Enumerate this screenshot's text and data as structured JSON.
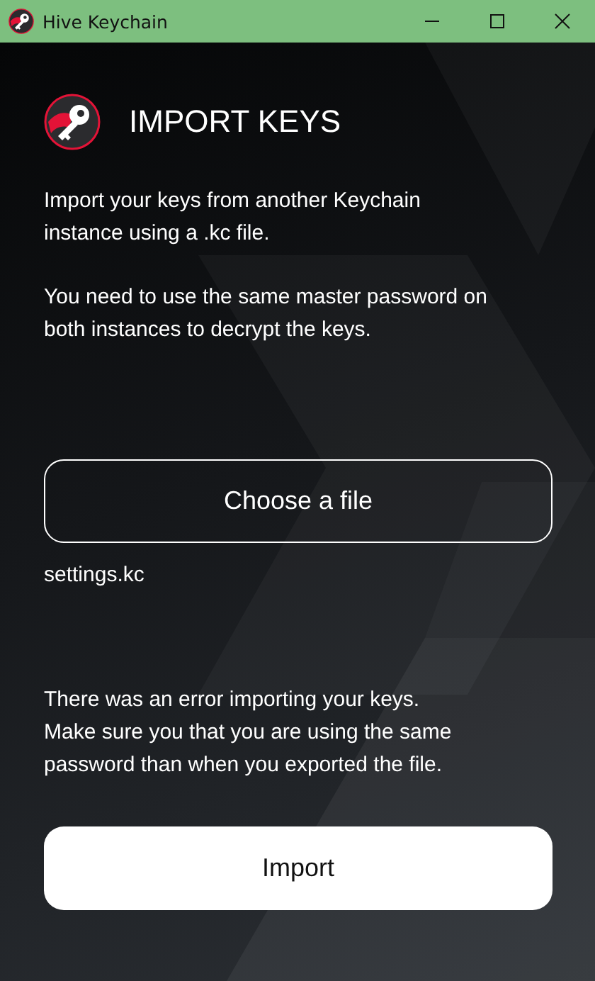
{
  "window": {
    "title": "Hive Keychain"
  },
  "page": {
    "title": "IMPORT KEYS",
    "paragraphs": [
      "Import your keys from another Keychain\ninstance using a .kc file.",
      "You need to use the same master password on\nboth instances to decrypt the keys."
    ],
    "choose_button": "Choose a file",
    "file_name": "settings.kc",
    "error_message": "There was an error importing your keys.\nMake sure you that you are using the same\npassword than when you exported the file.",
    "import_button": "Import"
  }
}
